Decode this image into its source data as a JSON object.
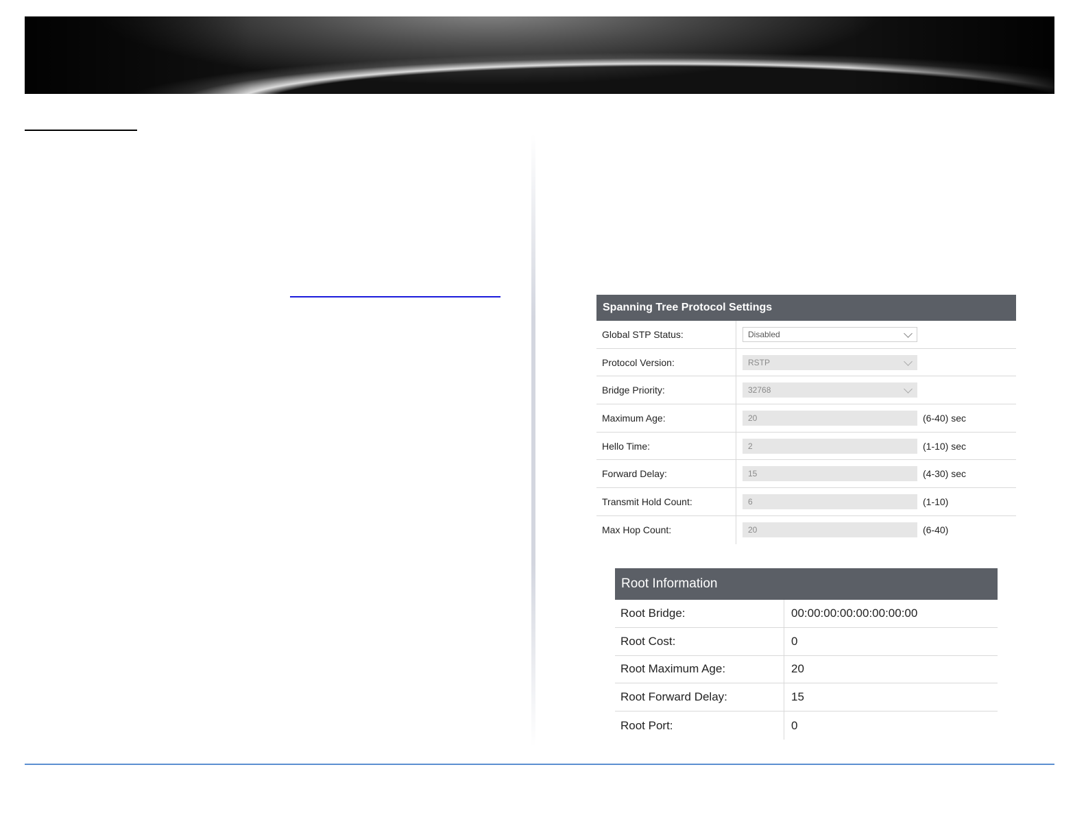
{
  "stp": {
    "title": "Spanning Tree Protocol Settings",
    "rows": [
      {
        "label": "Global STP Status:",
        "value": "Disabled",
        "type": "select",
        "enabled": true,
        "unit": ""
      },
      {
        "label": "Protocol Version:",
        "value": "RSTP",
        "type": "select",
        "enabled": false,
        "unit": ""
      },
      {
        "label": "Bridge Priority:",
        "value": "32768",
        "type": "select",
        "enabled": false,
        "unit": ""
      },
      {
        "label": "Maximum Age:",
        "value": "20",
        "type": "input",
        "enabled": false,
        "unit": "(6-40) sec"
      },
      {
        "label": "Hello Time:",
        "value": "2",
        "type": "input",
        "enabled": false,
        "unit": "(1-10) sec"
      },
      {
        "label": "Forward Delay:",
        "value": "15",
        "type": "input",
        "enabled": false,
        "unit": "(4-30) sec"
      },
      {
        "label": "Transmit Hold Count:",
        "value": "6",
        "type": "input",
        "enabled": false,
        "unit": "(1-10)"
      },
      {
        "label": "Max Hop Count:",
        "value": "20",
        "type": "input",
        "enabled": false,
        "unit": "(6-40)"
      }
    ]
  },
  "root": {
    "title": "Root Information",
    "rows": [
      {
        "label": "Root Bridge:",
        "value": "00:00:00:00:00:00:00:00"
      },
      {
        "label": "Root Cost:",
        "value": "0"
      },
      {
        "label": "Root Maximum Age:",
        "value": "20"
      },
      {
        "label": "Root Forward Delay:",
        "value": "15"
      },
      {
        "label": "Root Port:",
        "value": "0"
      }
    ]
  }
}
